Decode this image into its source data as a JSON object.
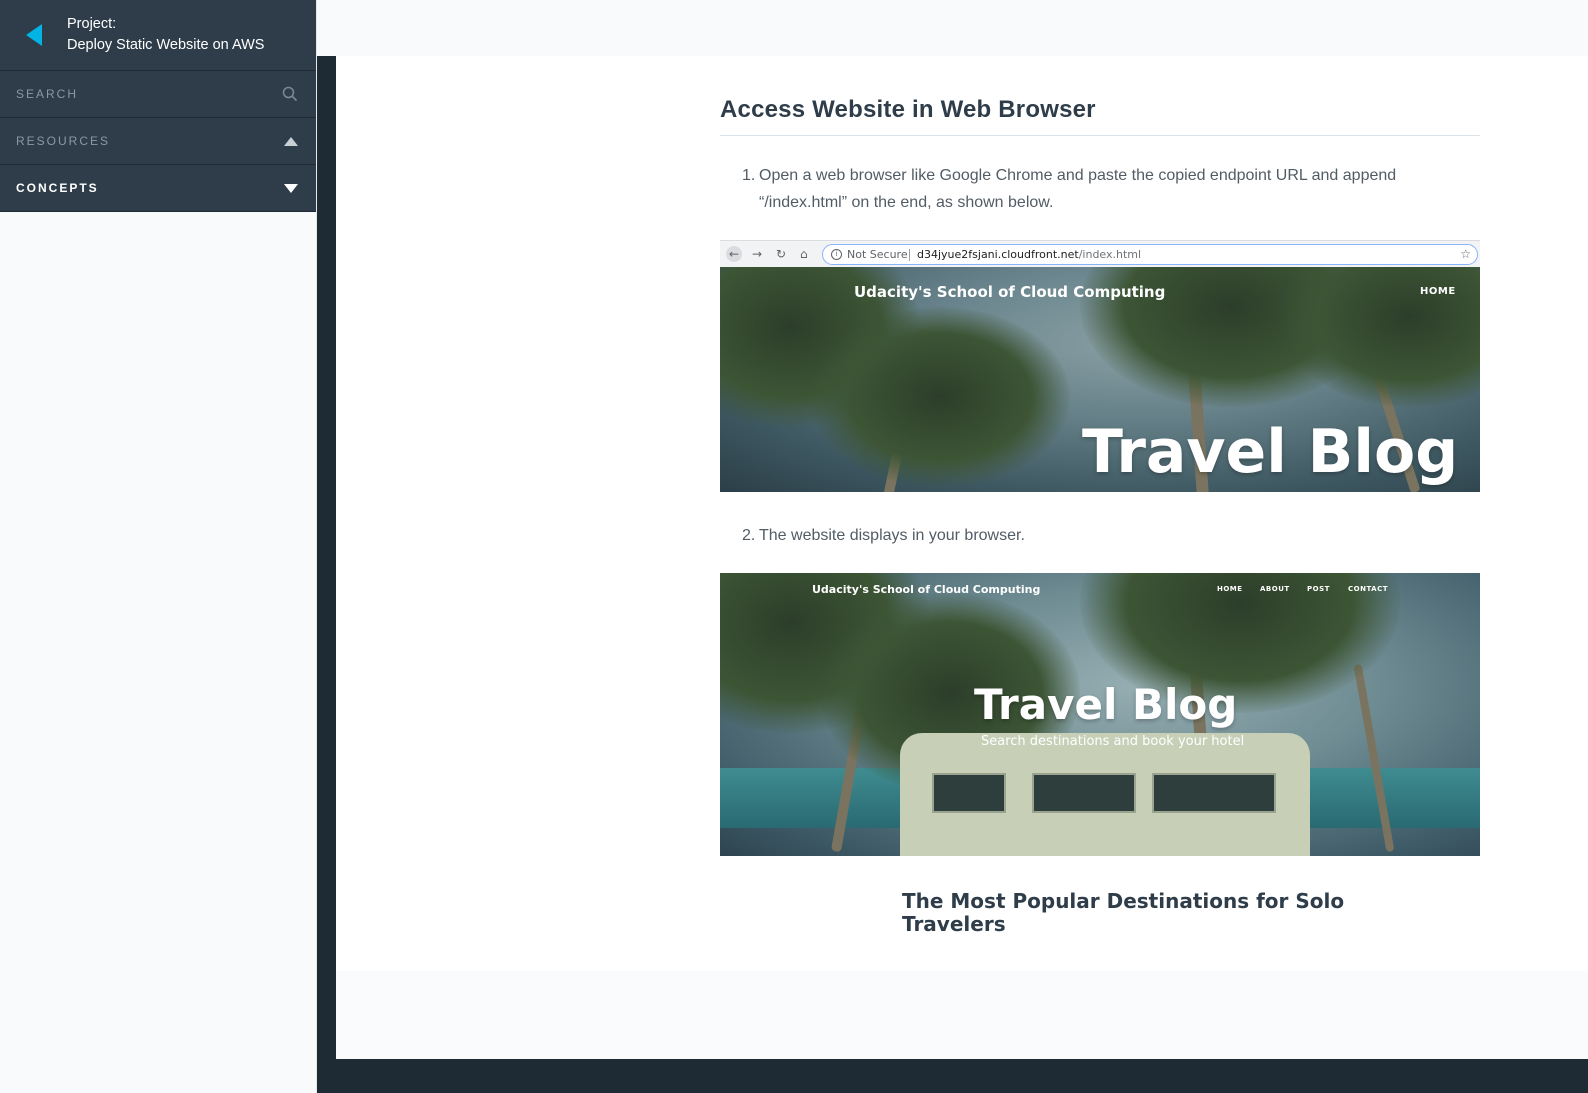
{
  "sidebar": {
    "project_label": "Project:",
    "project_name": "Deploy Static Website on AWS",
    "search_label": "SEARCH",
    "resources_label": "RESOURCES",
    "concepts_label": "CONCEPTS"
  },
  "article": {
    "title": "Access Website in Web Browser",
    "steps": [
      {
        "num": "1.",
        "text": "Open a web browser like Google Chrome and paste the copied endpoint URL and append “/index.html” on the end, as shown below."
      },
      {
        "num": "2.",
        "text": "The website displays in your browser."
      }
    ]
  },
  "screenshot1": {
    "not_secure": "Not Secure",
    "url_host": "d34jyue2fsjani.cloudfront.net",
    "url_path": "/index.html",
    "brand": "Udacity's School of Cloud Computing",
    "nav_home": "HOME",
    "title": "Travel Blog"
  },
  "screenshot2": {
    "brand": "Udacity's School of Cloud Computing",
    "nav": [
      "HOME",
      "ABOUT",
      "POST",
      "CONTACT"
    ],
    "title": "Travel Blog",
    "subtitle": "Search destinations and book your hotel",
    "section_heading": "The Most Popular Destinations for Solo Travelers"
  },
  "colors": {
    "sidebar_dark": "#2e3d49",
    "accent": "#02b3e4",
    "frame_dark": "#1f2b34"
  }
}
